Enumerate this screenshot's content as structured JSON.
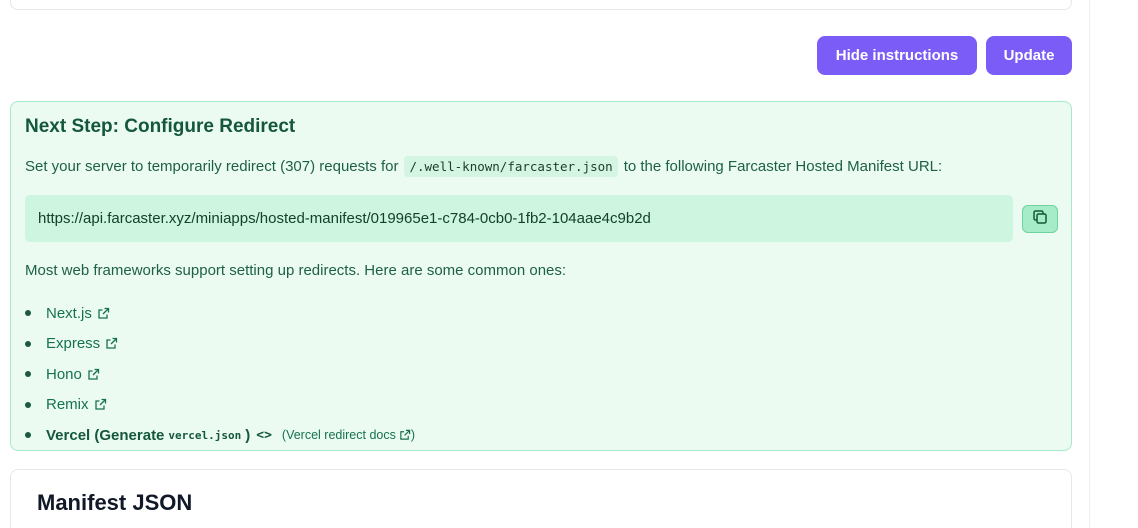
{
  "actions": {
    "hide_instructions_label": "Hide instructions",
    "update_label": "Update"
  },
  "redirect": {
    "title": "Next Step: Configure Redirect",
    "desc_before": "Set your server to temporarily redirect (307) requests for",
    "desc_code": "/.well-known/farcaster.json",
    "desc_after": "to the following Farcaster Hosted Manifest URL:",
    "url": "https://api.farcaster.xyz/miniapps/hosted-manifest/019965e1-c784-0cb0-1fb2-104aae4c9b2d",
    "copy_icon": "copy-icon",
    "intro": "Most web frameworks support setting up redirects. Here are some common ones:",
    "frameworks": [
      "Next.js",
      "Express",
      "Hono",
      "Remix"
    ],
    "vercel": {
      "label": "Vercel (Generate",
      "code": "vercel.json",
      "close": ")",
      "toggle": "<>",
      "docs": "(Vercel redirect docs"
    }
  },
  "manifest": {
    "title": "Manifest JSON"
  },
  "colors": {
    "accent": "#7c5cf6",
    "panel_bg": "#ebfbf2",
    "panel_border": "#a7e9c6",
    "link": "#16724e"
  }
}
